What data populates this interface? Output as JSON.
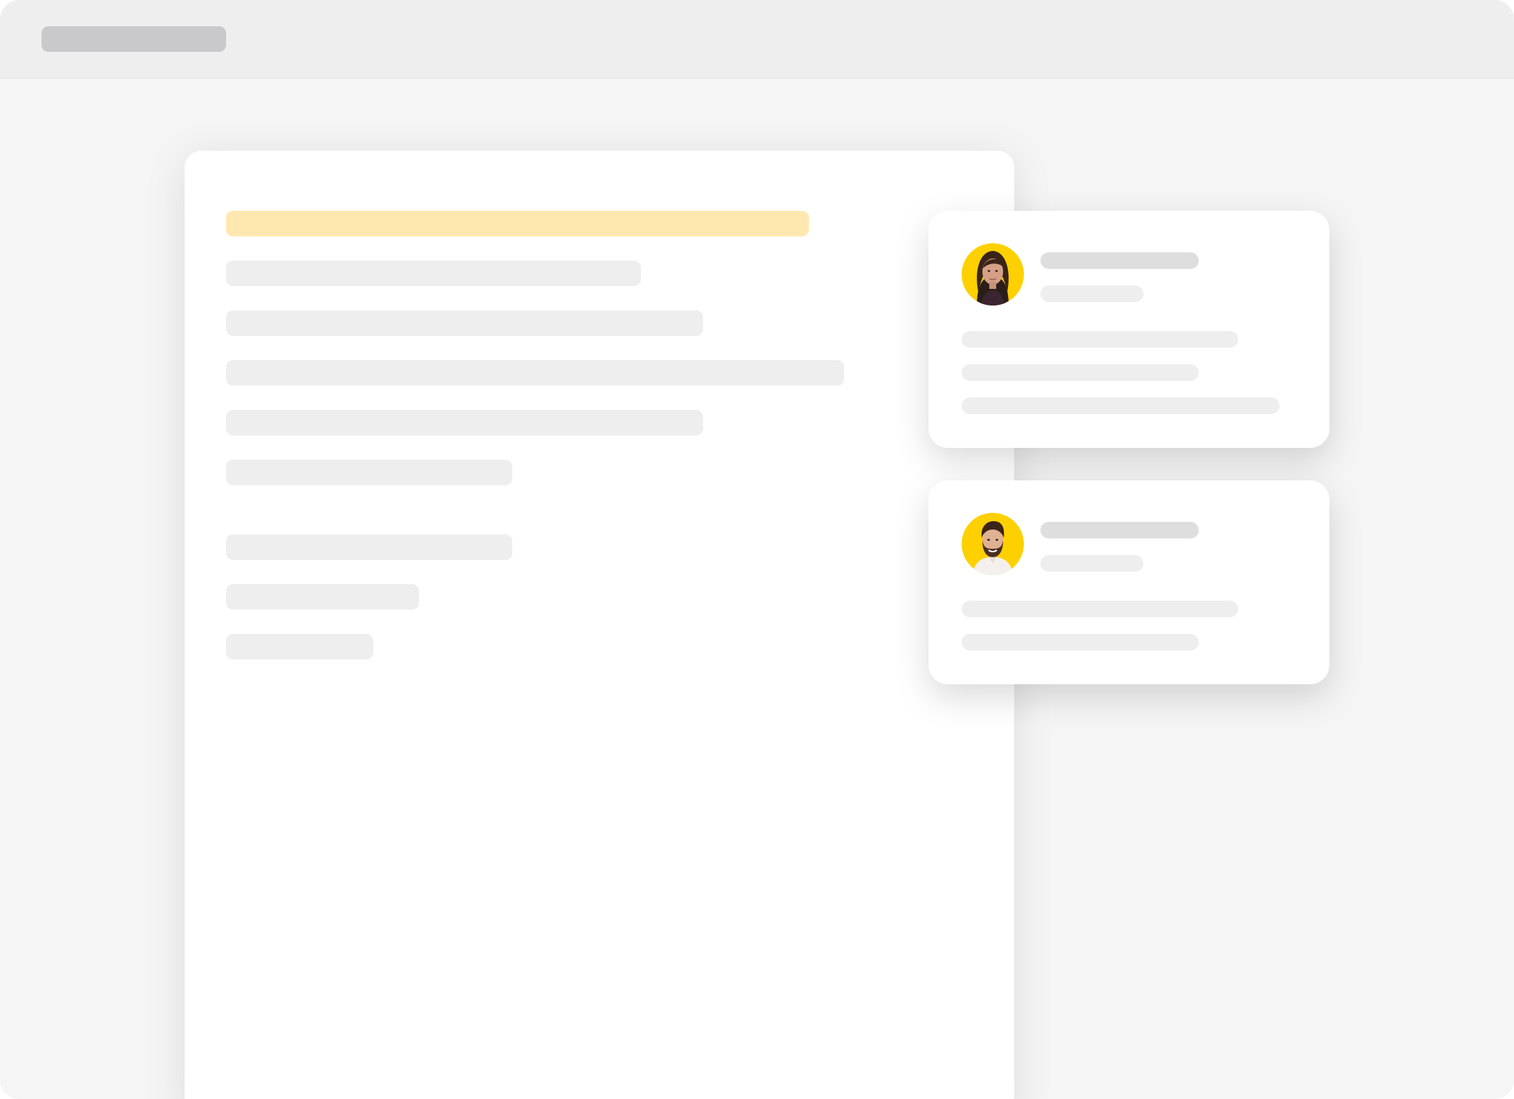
{
  "colors": {
    "window_background": "#f5f5f5",
    "titlebar_background": "#eeeeee",
    "title_placeholder": "#c9c9cc",
    "document_background": "#ffffff",
    "highlight_line": "#ffe8b0",
    "placeholder_line": "#eeeeee",
    "avatar_accent": "#ffd000"
  },
  "comments": [
    {
      "avatar_icon": "woman-avatar-icon"
    },
    {
      "avatar_icon": "bearded-man-avatar-icon"
    }
  ]
}
